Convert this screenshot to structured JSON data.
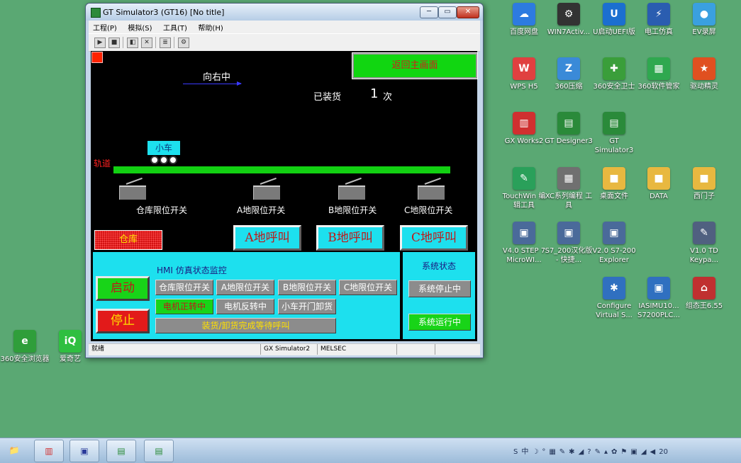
{
  "desktop": {
    "icons_right": [
      {
        "label": "百度网盘",
        "glyph": "☁",
        "color": "#2d7be0"
      },
      {
        "label": "WIN7Activ...",
        "glyph": "⚙",
        "color": "#333333"
      },
      {
        "label": "U启动UEFI版",
        "glyph": "U",
        "color": "#1b6fd0"
      },
      {
        "label": "电工仿真",
        "glyph": "⚡",
        "color": "#2a5db0"
      },
      {
        "label": "EV录屏",
        "glyph": "●",
        "color": "#3aa0e0"
      },
      {
        "label": "WPS H5",
        "glyph": "W",
        "color": "#e04040"
      },
      {
        "label": "360压缩",
        "glyph": "Z",
        "color": "#3a8ad8"
      },
      {
        "label": "360安全卫士",
        "glyph": "✚",
        "color": "#3a9e3a"
      },
      {
        "label": "360软件管家",
        "glyph": "▦",
        "color": "#2fa84f"
      },
      {
        "label": "驱动精灵",
        "glyph": "★",
        "color": "#e05020"
      },
      {
        "label": "GX Works2",
        "glyph": "▥",
        "color": "#d03030"
      },
      {
        "label": "GT Designer3",
        "glyph": "▤",
        "color": "#2a8a3a"
      },
      {
        "label": "GT Simulator3",
        "glyph": "▤",
        "color": "#2a8a3a"
      },
      {
        "label": "TouchWin 编辑工具",
        "glyph": "✎",
        "color": "#2aa05a"
      },
      {
        "label": "XC系列编程 工具",
        "glyph": "▦",
        "color": "#707070"
      },
      {
        "label": "桌面文件",
        "glyph": "■",
        "color": "#e8b840"
      },
      {
        "label": "DATA",
        "glyph": "■",
        "color": "#e8b840"
      },
      {
        "label": "西门子",
        "glyph": "■",
        "color": "#e8b840"
      },
      {
        "label": "V4.0 STEP 7 MicroWI...",
        "glyph": "▣",
        "color": "#4a6a9a"
      },
      {
        "label": "S7_200汉化版 - 快捷...",
        "glyph": "▣",
        "color": "#4a6a9a"
      },
      {
        "label": "V2.0 S7-200 Explorer",
        "glyph": "▣",
        "color": "#4a6a9a"
      },
      {
        "label": "V1.0 TD Keypa...",
        "glyph": "✎",
        "color": "#506080"
      },
      {
        "label": "Configure Virtual S...",
        "glyph": "✱",
        "color": "#3070c0"
      },
      {
        "label": "IASIMU10... S7200PLC...",
        "glyph": "▣",
        "color": "#3070c0"
      },
      {
        "label": "组态王6.55",
        "glyph": "⌂",
        "color": "#c03030"
      }
    ],
    "icons_left": [
      {
        "label": "360安全浏览器",
        "glyph": "e",
        "color": "#2f9e3a"
      },
      {
        "label": "爱奇艺",
        "glyph": "iQ",
        "color": "#2fbf40"
      }
    ]
  },
  "window": {
    "title": "GT Simulator3 (GT16)  [No title]",
    "min": "─",
    "max": "▭",
    "close": "✕",
    "menu": [
      "工程(P)",
      "模拟(S)",
      "工具(T)",
      "帮助(H)"
    ],
    "statusbar": {
      "left": "就绪",
      "mid1": "GX Simulator2",
      "mid2": "MELSEC"
    }
  },
  "hmi": {
    "back_button": "返回主画面",
    "direction": "向右中",
    "loaded_label": "已装货",
    "loaded_count": "1",
    "loaded_unit": "次",
    "cart_label": "小车",
    "track_label": "轨道",
    "limit_switches": [
      "仓库限位开关",
      "A地限位开关",
      "B地限位开关",
      "C地限位开关"
    ],
    "warehouse": "仓库",
    "call_buttons": [
      "A地呼叫",
      "B地呼叫",
      "C地呼叫"
    ],
    "monitor": {
      "title": "HMI 仿真状态监控",
      "start": "启动",
      "stop": "停止",
      "indicators_row1": [
        "仓库限位开关",
        "A地限位开关",
        "B地限位开关",
        "C地限位开关"
      ],
      "motor_fwd": "电机正转中",
      "motor_rev": "电机反转中",
      "unload": "小车开门卸货",
      "wait": "装货/卸货完成等待呼叫"
    },
    "system": {
      "title": "系统状态",
      "stopped": "系统停止中",
      "running": "系统运行中"
    },
    "colors": {
      "green": "#18d418",
      "cyan": "#1de0ee",
      "red": "#d41212",
      "grey": "#8c8c8c"
    }
  },
  "taskbar": {
    "items": [
      "📁",
      "▥",
      "▣",
      "▤",
      "▤"
    ],
    "tray": [
      "S",
      "中",
      "☽",
      "°",
      "▦",
      "✎",
      "✱",
      "◢",
      "?",
      "✎",
      "▴",
      "✿",
      "⚑",
      "▣",
      "◢",
      "◀"
    ],
    "clock": "20"
  }
}
